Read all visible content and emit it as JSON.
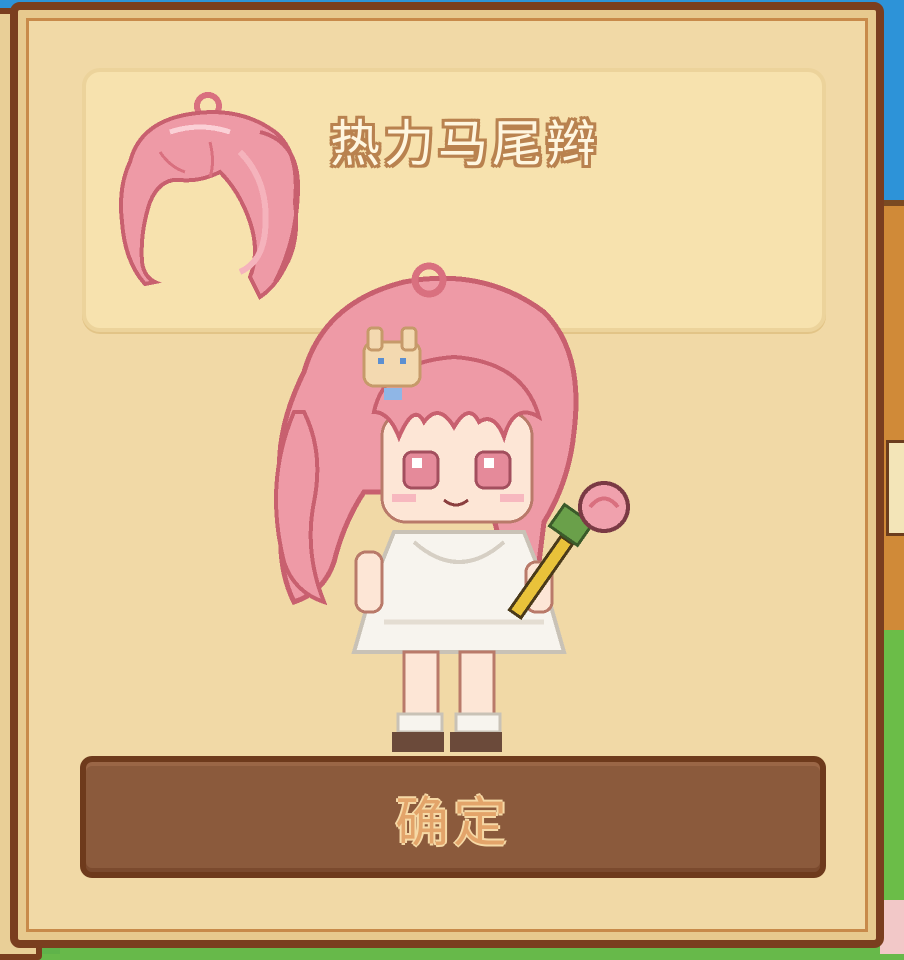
{
  "dialog": {
    "item_name": "热力马尾辫",
    "item_icon": "pink-ponytail-hair-icon",
    "preview": "character-wearing-pink-ponytail"
  },
  "buttons": {
    "confirm_label": "确定"
  },
  "colors": {
    "panel_bg": "#f1d9a6",
    "panel_border": "#7a3e1f",
    "button_bg": "#8b5a3c",
    "hair_pink": "#e88f9c"
  }
}
